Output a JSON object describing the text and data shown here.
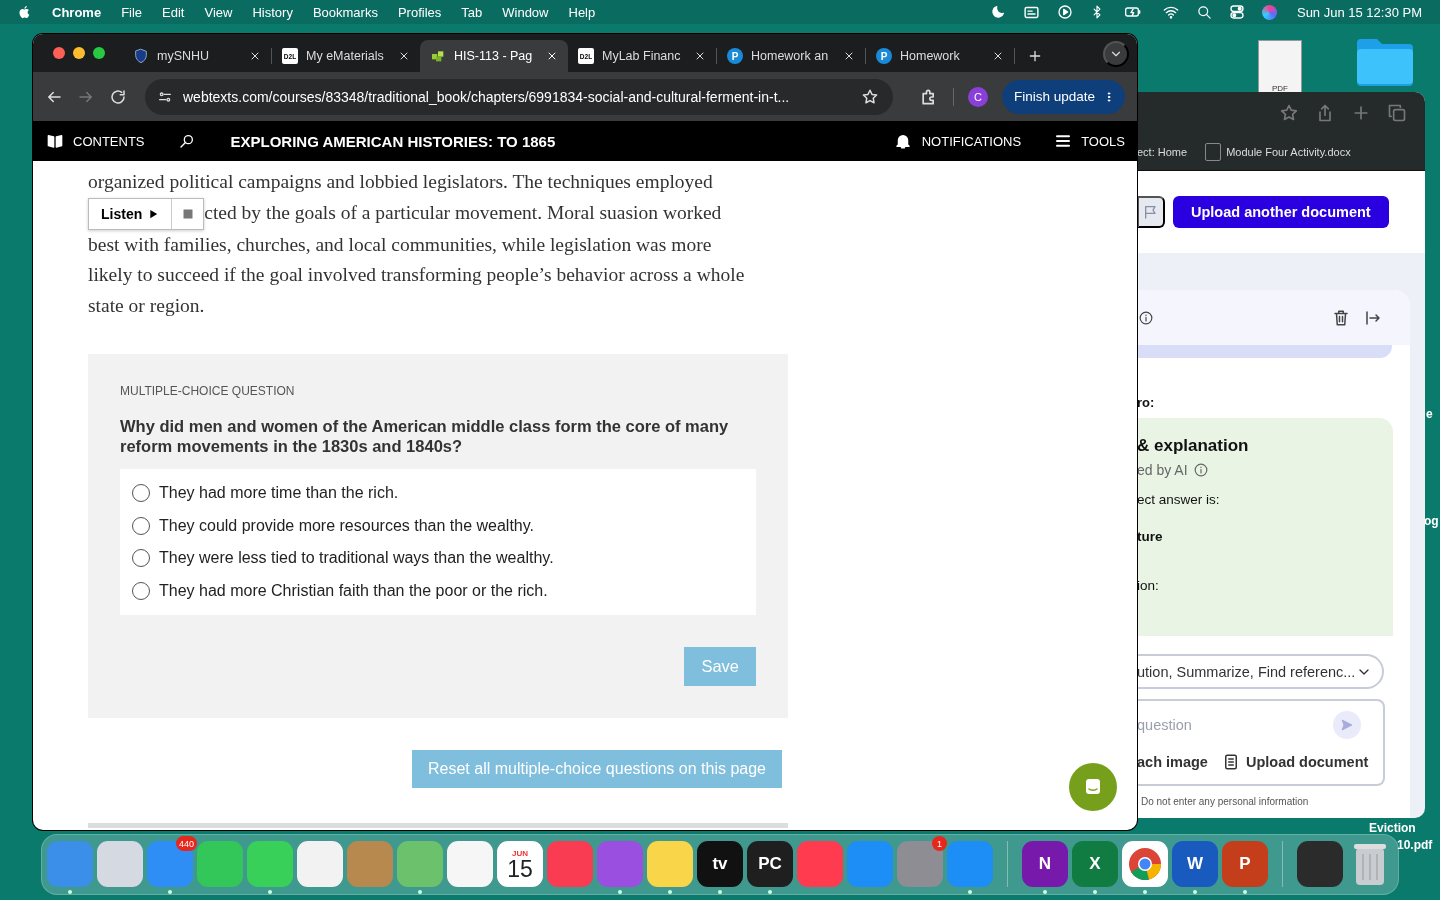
{
  "menu_bar": {
    "app_name": "Chrome",
    "menus": [
      "File",
      "Edit",
      "View",
      "History",
      "Bookmarks",
      "Profiles",
      "Tab",
      "Window",
      "Help"
    ],
    "status_icons": [
      {
        "kind": "moon"
      },
      {
        "kind": "screen"
      },
      {
        "kind": "play"
      },
      {
        "kind": "bluetooth"
      },
      {
        "kind": "battery"
      },
      {
        "kind": "wifi"
      },
      {
        "kind": "search"
      },
      {
        "kind": "control"
      },
      {
        "kind": "siri"
      }
    ],
    "clock": "Sun Jun 15  12:30 PM"
  },
  "desktop": {
    "file_badge": "PDF",
    "labels": [
      "e",
      "og",
      "Eviction",
      "10.pdf"
    ]
  },
  "back_window": {
    "toolbar_icons": [
      {
        "kind": "star"
      },
      {
        "kind": "share"
      },
      {
        "kind": "plus"
      },
      {
        "kind": "tabs"
      }
    ],
    "bookmarks": [
      {
        "label": "ect: Home",
        "icon": false
      },
      {
        "label": "Module Four Activity.docx",
        "icon": true
      }
    ],
    "upload_button": "Upload another document",
    "section_label": "ro:",
    "answer_card": {
      "title": "& explanation",
      "subtitle": "ed by AI",
      "intro": "ect answer is:",
      "answer": "ture",
      "explanation_label": "ion:"
    },
    "action_select": "ution, Summarize, Find referenc...",
    "question_input": {
      "placeholder": "question"
    },
    "attach_image": "ach image",
    "upload_document": "Upload document",
    "disclaimer": "Do not enter any personal information"
  },
  "browser": {
    "tabs": [
      {
        "title": "mySNHU",
        "kind": "shield",
        "selected": false
      },
      {
        "title": "My eMaterials",
        "kind": "d2l",
        "icon_text": "D2L",
        "selected": false
      },
      {
        "title": "HIS-113 - Pag",
        "kind": "puzzle",
        "selected": true
      },
      {
        "title": "MyLab Financ",
        "kind": "d2l",
        "icon_text": "D2L",
        "selected": false
      },
      {
        "title": "Homework an",
        "kind": "p",
        "icon_text": "P",
        "selected": false
      },
      {
        "title": "Homework",
        "kind": "p",
        "icon_text": "P",
        "selected": false
      }
    ],
    "nav_buttons": [
      {
        "kind": "back",
        "disabled": false
      },
      {
        "kind": "forward",
        "disabled": true
      },
      {
        "kind": "reload",
        "disabled": false
      }
    ],
    "url": "webtexts.com/courses/83348/traditional_book/chapters/6991834-social-and-cultural-ferment-in-t...",
    "profile_initial": "C",
    "update_button": "Finish update"
  },
  "reader": {
    "contents": "CONTENTS",
    "book_title": "EXPLORING AMERICAN HISTORIES: TO 1865",
    "notifications": "NOTIFICATIONS",
    "tools": "TOOLS",
    "listen_button": "Listen",
    "paragraph_lines": [
      "organized political campaigns and lobbied legislators. The techniques employed",
      "cted by the goals of a particular movement. Moral suasion worked",
      "best with families, churches, and local communities, while legislation was more",
      "likely to succeed if the goal involved transforming people’s behavior across a whole",
      "state or region."
    ],
    "question": {
      "label": "MULTIPLE-CHOICE QUESTION",
      "prompt": "Why did men and women of the American middle class form the core of many reform movements in the 1830s and 1840s?",
      "options": [
        {
          "text": "They had more time than the rich.",
          "selected": false
        },
        {
          "text": "They could provide more resources than the wealthy.",
          "selected": false
        },
        {
          "text": "They were less tied to traditional ways than the wealthy.",
          "selected": false
        },
        {
          "text": "They had more Christian faith than the poor or the rich.",
          "selected": false
        }
      ],
      "save_button": {
        "label": "Save",
        "disabled": true
      }
    },
    "reset_button": {
      "label": "Reset all multiple-choice questions on this page",
      "disabled": true
    }
  },
  "dock": {
    "items": [
      {
        "kind": "app",
        "color": "#3b8fe8",
        "running": true
      },
      {
        "kind": "app",
        "color": "#d5dae2",
        "running": false
      },
      {
        "kind": "app",
        "color": "#2f8ef5",
        "badge": "440",
        "running": true
      },
      {
        "kind": "app",
        "color": "#33c759",
        "running": false
      },
      {
        "kind": "app",
        "color": "#39d05a",
        "running": true
      },
      {
        "kind": "app",
        "color": "#f2f2f2",
        "running": false
      },
      {
        "kind": "app",
        "color": "#b8894f",
        "running": false
      },
      {
        "kind": "app",
        "color": "#6cc26c",
        "running": true
      },
      {
        "kind": "app",
        "color": "#f6f6f6",
        "running": false
      },
      {
        "kind": "calendar",
        "color": "#ffffff",
        "label_top": "JUN",
        "label": "15",
        "running": false
      },
      {
        "kind": "app",
        "color": "#fa3c52",
        "running": false
      },
      {
        "kind": "app",
        "color": "#9a4fe0",
        "running": true
      },
      {
        "kind": "app",
        "color": "#f9d54a",
        "running": true
      },
      {
        "kind": "app",
        "color": "#111111",
        "label": "tv",
        "running": true
      },
      {
        "kind": "app",
        "color": "#1f1f1f",
        "label": "PC",
        "running": true
      },
      {
        "kind": "app",
        "color": "#ff3b4f",
        "running": false
      },
      {
        "kind": "app",
        "color": "#1d8ef5",
        "running": false
      },
      {
        "kind": "app",
        "color": "#8d8d93",
        "badge": "1",
        "running": false
      },
      {
        "kind": "app",
        "color": "#1d8ef5",
        "running": true
      },
      {
        "kind": "separator"
      },
      {
        "kind": "app",
        "color": "#7719aa",
        "label": "N",
        "running": true
      },
      {
        "kind": "app",
        "color": "#107c41",
        "label": "X",
        "running": true
      },
      {
        "kind": "chrome",
        "color": "#ffffff",
        "running": true
      },
      {
        "kind": "app",
        "color": "#185abd",
        "label": "W",
        "running": true
      },
      {
        "kind": "app",
        "color": "#c43e1c",
        "label": "P",
        "running": true
      },
      {
        "kind": "separator"
      },
      {
        "kind": "app",
        "color": "#2b2b2b",
        "running": false
      },
      {
        "kind": "trash",
        "color": "#c9ccd0",
        "running": false
      }
    ]
  }
}
